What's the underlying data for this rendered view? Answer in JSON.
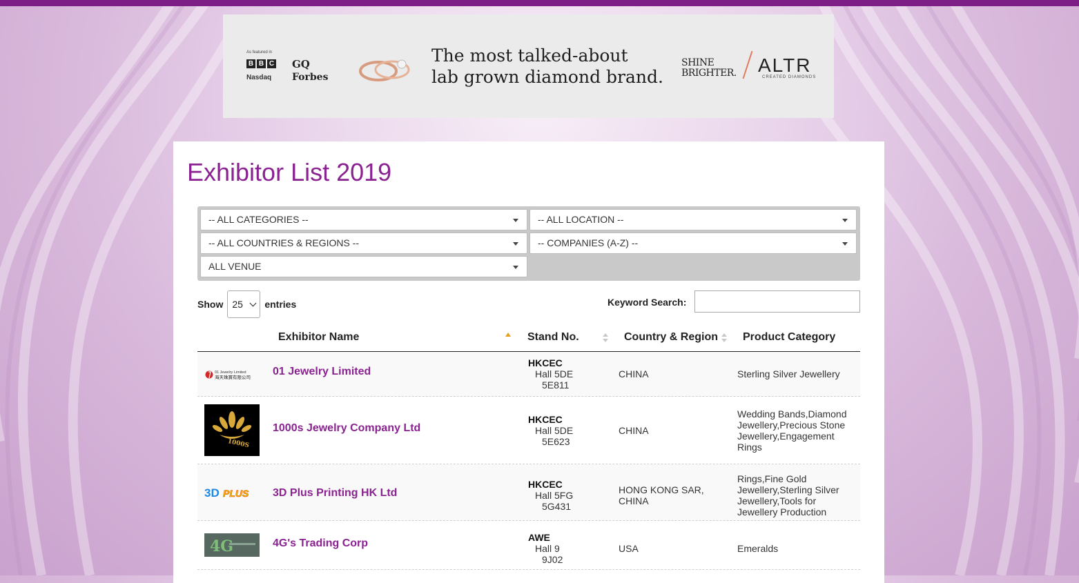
{
  "ad": {
    "featured_label": "As featured in",
    "outlets": [
      "BBC",
      "GQ",
      "Nasdaq",
      "Forbes"
    ],
    "headline_line1": "The most talked-about",
    "headline_line2": "lab grown diamond brand.",
    "tagline_line1": "SHINE",
    "tagline_line2": "BRIGHTER.",
    "brand": "ALTR",
    "brand_sub": "CREATED DIAMONDS"
  },
  "page": {
    "title": "Exhibitor List 2019"
  },
  "filters": {
    "categories": "-- ALL CATEGORIES --",
    "location": "-- ALL LOCATION --",
    "countries": "-- ALL COUNTRIES & REGIONS --",
    "companies": "-- COMPANIES (A-Z) --",
    "venue": "ALL VENUE"
  },
  "controls": {
    "show_label": "Show",
    "page_size": "25",
    "entries_label": "entries",
    "keyword_label": "Keyword Search:",
    "keyword_value": ""
  },
  "table": {
    "headers": [
      "Exhibitor Name",
      "Stand No.",
      "Country & Region",
      "Product Category"
    ],
    "rows": [
      {
        "name": "01 Jewelry Limited",
        "venue": "HKCEC",
        "hall": "Hall 5DE",
        "stand": "5E811",
        "country": "CHINA",
        "category": "Sterling Silver Jewellery",
        "logo_text_1": "01 Jewelry Limited",
        "logo_text_2": "海天珠寶有限公司"
      },
      {
        "name": "1000s Jewelry Company Ltd",
        "venue": "HKCEC",
        "hall": "Hall 5DE",
        "stand": "5E623",
        "country": "CHINA",
        "category": "Wedding Bands,Diamond Jewellery,Precious Stone Jewellery,Engagement Rings",
        "logo_text_1": "1000S"
      },
      {
        "name": "3D Plus Printing HK Ltd",
        "venue": "HKCEC",
        "hall": "Hall 5FG",
        "stand": "5G431",
        "country": "HONG KONG SAR, CHINA",
        "category": "Rings,Fine Gold Jewellery,Sterling Silver Jewellery,Tools for Jewellery Production",
        "logo_text_1": "3D",
        "logo_text_2": "PLUS"
      },
      {
        "name": "4G's Trading Corp",
        "venue": "AWE",
        "hall": "Hall 9",
        "stand": "9J02",
        "country": "USA",
        "category": "Emeralds",
        "logo_text_1": "4G"
      }
    ]
  },
  "colors": {
    "brand_purple": "#8a2391",
    "top_bar": "#7d1d86",
    "sort_active": "#e4a11b"
  }
}
